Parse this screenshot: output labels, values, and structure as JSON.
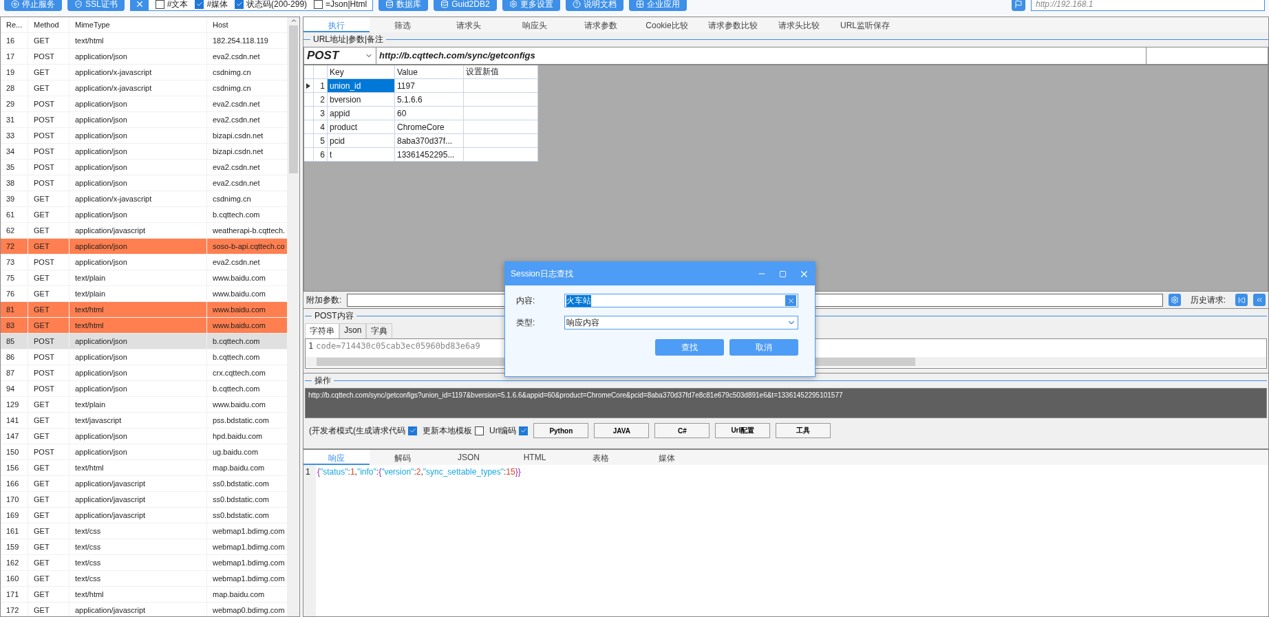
{
  "toolbar": {
    "buttons": [
      {
        "label": "停止服务",
        "kind": "stop"
      },
      {
        "label": "SSL证书",
        "kind": "cert"
      }
    ],
    "filters": [
      {
        "label": "#文本",
        "checked": false
      },
      {
        "label": "#媒体",
        "checked": true
      },
      {
        "label": "状态码(200-299)",
        "checked": true
      },
      {
        "label": "=Json|Html",
        "checked": false
      }
    ],
    "actions": [
      {
        "label": "数据库",
        "kind": "db"
      },
      {
        "label": "Guid2DB2",
        "kind": "db"
      },
      {
        "label": "更多设置",
        "kind": "gear"
      },
      {
        "label": "说明文档",
        "kind": "help"
      },
      {
        "label": "企业应用",
        "kind": "app"
      }
    ],
    "address": "http://192.168.1"
  },
  "sessions": {
    "columns": [
      "Re...",
      "Method",
      "MimeType",
      "Host"
    ],
    "rows": [
      {
        "id": "16",
        "method": "GET",
        "mime": "text/html",
        "host": "182.254.118.119",
        "highlighted": false,
        "selected": false
      },
      {
        "id": "17",
        "method": "POST",
        "mime": "application/json",
        "host": "eva2.csdn.net",
        "highlighted": false,
        "selected": false
      },
      {
        "id": "19",
        "method": "GET",
        "mime": "application/x-javascript",
        "host": "csdnimg.cn",
        "highlighted": false,
        "selected": false
      },
      {
        "id": "28",
        "method": "GET",
        "mime": "application/x-javascript",
        "host": "csdnimg.cn",
        "highlighted": false,
        "selected": false
      },
      {
        "id": "29",
        "method": "POST",
        "mime": "application/json",
        "host": "eva2.csdn.net",
        "highlighted": false,
        "selected": false
      },
      {
        "id": "31",
        "method": "POST",
        "mime": "application/json",
        "host": "eva2.csdn.net",
        "highlighted": false,
        "selected": false
      },
      {
        "id": "33",
        "method": "POST",
        "mime": "application/json",
        "host": "bizapi.csdn.net",
        "highlighted": false,
        "selected": false
      },
      {
        "id": "34",
        "method": "POST",
        "mime": "application/json",
        "host": "bizapi.csdn.net",
        "highlighted": false,
        "selected": false
      },
      {
        "id": "35",
        "method": "POST",
        "mime": "application/json",
        "host": "eva2.csdn.net",
        "highlighted": false,
        "selected": false
      },
      {
        "id": "38",
        "method": "POST",
        "mime": "application/json",
        "host": "eva2.csdn.net",
        "highlighted": false,
        "selected": false
      },
      {
        "id": "39",
        "method": "GET",
        "mime": "application/x-javascript",
        "host": "csdnimg.cn",
        "highlighted": false,
        "selected": false
      },
      {
        "id": "61",
        "method": "GET",
        "mime": "application/json",
        "host": "b.cqttech.com",
        "highlighted": false,
        "selected": false
      },
      {
        "id": "62",
        "method": "GET",
        "mime": "application/javascript",
        "host": "weatherapi-b.cqttech.",
        "highlighted": false,
        "selected": false
      },
      {
        "id": "72",
        "method": "GET",
        "mime": "application/json",
        "host": "soso-b-api.cqttech.co",
        "highlighted": true,
        "selected": false
      },
      {
        "id": "73",
        "method": "POST",
        "mime": "application/json",
        "host": "eva2.csdn.net",
        "highlighted": false,
        "selected": false
      },
      {
        "id": "75",
        "method": "GET",
        "mime": "text/plain",
        "host": "www.baidu.com",
        "highlighted": false,
        "selected": false
      },
      {
        "id": "76",
        "method": "GET",
        "mime": "text/plain",
        "host": "www.baidu.com",
        "highlighted": false,
        "selected": false
      },
      {
        "id": "81",
        "method": "GET",
        "mime": "text/html",
        "host": "www.baidu.com",
        "highlighted": true,
        "selected": false
      },
      {
        "id": "83",
        "method": "GET",
        "mime": "text/html",
        "host": "www.baidu.com",
        "highlighted": true,
        "selected": false
      },
      {
        "id": "85",
        "method": "POST",
        "mime": "application/json",
        "host": "b.cqttech.com",
        "highlighted": false,
        "selected": true
      },
      {
        "id": "86",
        "method": "POST",
        "mime": "application/json",
        "host": "b.cqttech.com",
        "highlighted": false,
        "selected": false
      },
      {
        "id": "87",
        "method": "POST",
        "mime": "application/json",
        "host": "crx.cqttech.com",
        "highlighted": false,
        "selected": false
      },
      {
        "id": "94",
        "method": "POST",
        "mime": "application/json",
        "host": "b.cqttech.com",
        "highlighted": false,
        "selected": false
      },
      {
        "id": "129",
        "method": "GET",
        "mime": "text/plain",
        "host": "www.baidu.com",
        "highlighted": false,
        "selected": false
      },
      {
        "id": "141",
        "method": "GET",
        "mime": "text/javascript",
        "host": "pss.bdstatic.com",
        "highlighted": false,
        "selected": false
      },
      {
        "id": "147",
        "method": "GET",
        "mime": "application/json",
        "host": "hpd.baidu.com",
        "highlighted": false,
        "selected": false
      },
      {
        "id": "150",
        "method": "POST",
        "mime": "application/json",
        "host": "ug.baidu.com",
        "highlighted": false,
        "selected": false
      },
      {
        "id": "156",
        "method": "GET",
        "mime": "text/html",
        "host": "map.baidu.com",
        "highlighted": false,
        "selected": false
      },
      {
        "id": "166",
        "method": "GET",
        "mime": "application/javascript",
        "host": "ss0.bdstatic.com",
        "highlighted": false,
        "selected": false
      },
      {
        "id": "170",
        "method": "GET",
        "mime": "application/javascript",
        "host": "ss0.bdstatic.com",
        "highlighted": false,
        "selected": false
      },
      {
        "id": "169",
        "method": "GET",
        "mime": "application/javascript",
        "host": "ss0.bdstatic.com",
        "highlighted": false,
        "selected": false
      },
      {
        "id": "161",
        "method": "GET",
        "mime": "text/css",
        "host": "webmap1.bdimg.com",
        "highlighted": false,
        "selected": false
      },
      {
        "id": "159",
        "method": "GET",
        "mime": "text/css",
        "host": "webmap1.bdimg.com",
        "highlighted": false,
        "selected": false
      },
      {
        "id": "162",
        "method": "GET",
        "mime": "text/css",
        "host": "webmap1.bdimg.com",
        "highlighted": false,
        "selected": false
      },
      {
        "id": "160",
        "method": "GET",
        "mime": "text/css",
        "host": "webmap1.bdimg.com",
        "highlighted": false,
        "selected": false
      },
      {
        "id": "171",
        "method": "GET",
        "mime": "text/html",
        "host": "map.baidu.com",
        "highlighted": false,
        "selected": false
      },
      {
        "id": "172",
        "method": "GET",
        "mime": "application/javascript",
        "host": "webmap0.bdimg.com",
        "highlighted": false,
        "selected": false
      }
    ]
  },
  "request_tabs": [
    {
      "label": "执行",
      "selected": true
    },
    {
      "label": "筛选",
      "selected": false
    },
    {
      "label": "请求头",
      "selected": false
    },
    {
      "label": "响应头",
      "selected": false
    },
    {
      "label": "请求参数",
      "selected": false
    },
    {
      "label": "Cookie比较",
      "selected": false
    },
    {
      "label": "请求参数比较",
      "selected": false
    },
    {
      "label": "请求头比较",
      "selected": false
    },
    {
      "label": "URL监听保存",
      "selected": false
    }
  ],
  "url_section": {
    "legend": "URL地址|参数|备注",
    "method": "POST",
    "url": "http://b.cqttech.com/sync/getconfigs",
    "params": {
      "columns": [
        "Key",
        "Value",
        "设置新值"
      ],
      "rows": [
        {
          "index": "1",
          "key": "union_id",
          "value": "1197",
          "selected": true
        },
        {
          "index": "2",
          "key": "bversion",
          "value": "5.1.6.6",
          "selected": false
        },
        {
          "index": "3",
          "key": "appid",
          "value": "60",
          "selected": false
        },
        {
          "index": "4",
          "key": "product",
          "value": "ChromeCore",
          "selected": false
        },
        {
          "index": "5",
          "key": "pcid",
          "value": "8aba370d37f...",
          "selected": false
        },
        {
          "index": "6",
          "key": "t",
          "value": "13361452295...",
          "selected": false
        }
      ]
    },
    "extra_label": "附加参数:",
    "history_label": "历史请求:"
  },
  "post_section": {
    "legend": "POST内容",
    "tabs": [
      {
        "label": "字符串",
        "selected": true
      },
      {
        "label": "Json",
        "selected": false
      },
      {
        "label": "字典",
        "selected": false
      }
    ],
    "line_number": "1",
    "code": "code=714430c05cab3ec05960bd83e6a9"
  },
  "action_section": {
    "legend": "操作",
    "full_url": "http://b.cqttech.com/sync/getconfigs?union_id=1197&bversion=5.1.6.6&appid=60&product=ChromeCore&pcid=8aba370d37fd7e8c81e679c503d891e6&t=13361452295101577",
    "options": [
      {
        "label": "(开发者模式(生成请求代码",
        "checked": true
      },
      {
        "label": "更新本地模板",
        "checked": false
      },
      {
        "label": "Url编码",
        "checked": true
      }
    ],
    "buttons": [
      "Python",
      "JAVA",
      "C#",
      "Url配置",
      "工具"
    ]
  },
  "response_tabs": [
    {
      "label": "响应",
      "selected": true
    },
    {
      "label": "解码",
      "selected": false
    },
    {
      "label": "JSON",
      "selected": false
    },
    {
      "label": "HTML",
      "selected": false
    },
    {
      "label": "表格",
      "selected": false
    },
    {
      "label": "媒体",
      "selected": false
    }
  ],
  "response": {
    "line_number": "1",
    "text": "{\"status\":1,\"info\":{\"version\":2,\"sync_settable_types\":15}}"
  },
  "dialog": {
    "title": "Session日志查找",
    "content_label": "内容:",
    "content_value": "火车站",
    "type_label": "类型:",
    "type_value": "响应内容",
    "buttons": [
      "查找",
      "取消"
    ]
  }
}
